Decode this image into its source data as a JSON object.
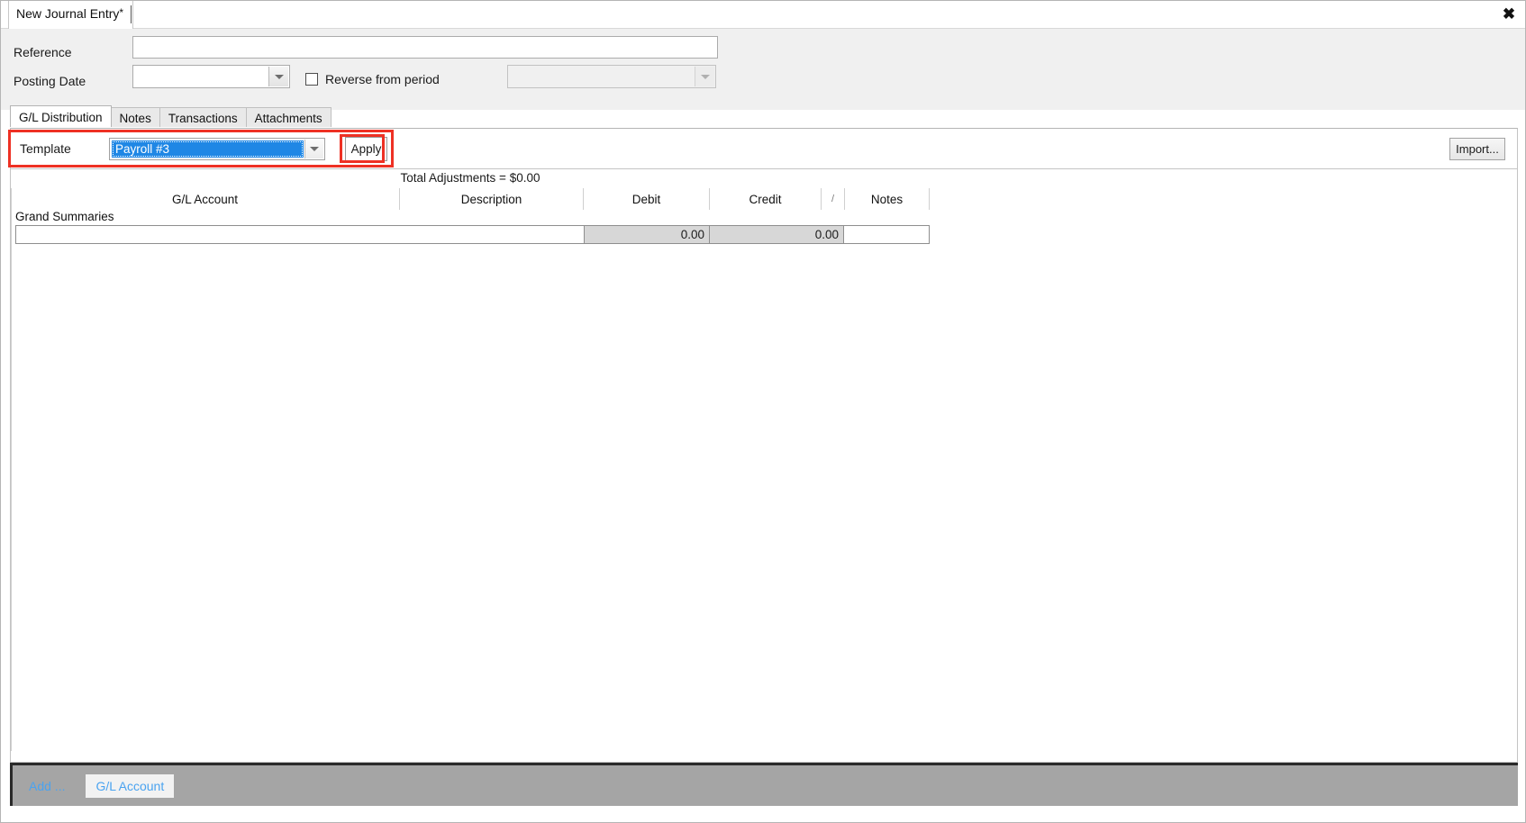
{
  "window": {
    "doc_tab_title": "New Journal Entry",
    "modified_marker": "*",
    "close_icon": "close-icon",
    "close_glyph": "✖"
  },
  "form": {
    "reference_label": "Reference",
    "reference_value": "",
    "reference_placeholder": "",
    "posting_date_label": "Posting Date",
    "posting_date_value": "",
    "reverse_checkbox_label": "Reverse from period",
    "reverse_checked": false,
    "reverse_period_value": "",
    "reverse_period_enabled": false
  },
  "tabs": [
    {
      "label": "G/L Distribution",
      "active": true
    },
    {
      "label": "Notes",
      "active": false
    },
    {
      "label": "Transactions",
      "active": false
    },
    {
      "label": "Attachments",
      "active": false
    }
  ],
  "template_bar": {
    "label": "Template",
    "selected_template": "Payroll #3",
    "apply_label": "Apply",
    "import_label": "Import...",
    "highlight_color": "#ee3124",
    "selection_color": "#1f87e5"
  },
  "grid": {
    "total_adjustments_text": "Total Adjustments = $0.00",
    "columns": [
      "G/L Account",
      "Description",
      "Debit",
      "Credit",
      "/",
      "Notes"
    ],
    "section_label": "Grand Summaries",
    "summary_row": {
      "gl_account": "",
      "description": "",
      "debit": "0.00",
      "credit": "0.00",
      "flag": "",
      "notes": ""
    }
  },
  "footer": {
    "add_label": "Add ...",
    "gl_account_button": "G/L Account",
    "bar_color": "#a5a5a5",
    "link_color": "#4aa3f0"
  }
}
